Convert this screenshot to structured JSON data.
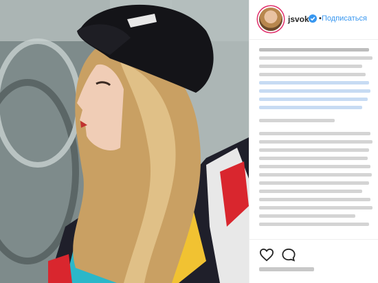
{
  "post": {
    "username": "jsvok",
    "follow_label": "Подписаться",
    "dot": "•",
    "icons": {
      "avatar": "avatar",
      "verified": "verified-badge-icon",
      "like": "heart-icon",
      "comment": "comment-icon"
    },
    "colors": {
      "accent": "#3897f0",
      "ring": "#e1306c"
    }
  }
}
